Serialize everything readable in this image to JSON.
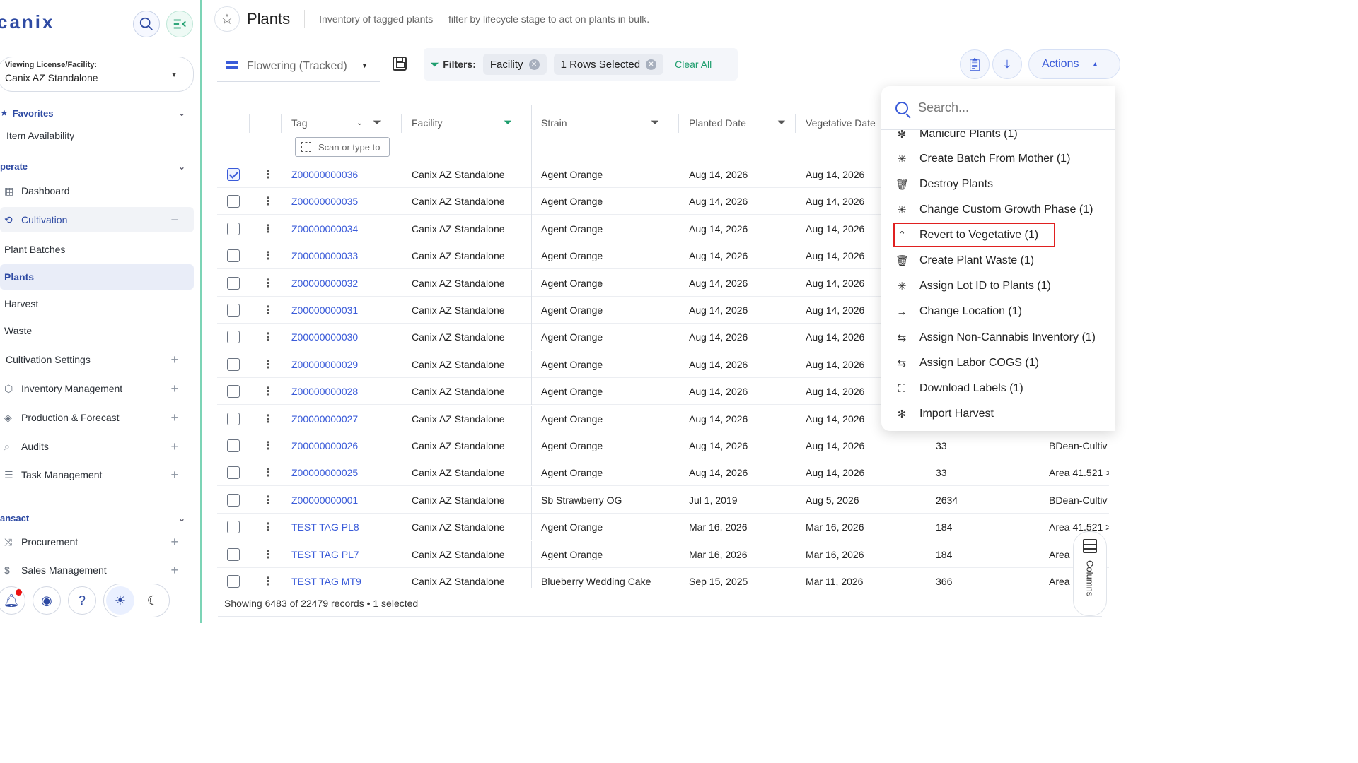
{
  "app": {
    "logo": "canix"
  },
  "sidebar": {
    "license_label": "Viewing License/Facility:",
    "license_value": "Canix AZ Standalone",
    "favorites_label": "Favorites",
    "favorite_item": "Item Availability",
    "operate_label": "perate",
    "items": [
      {
        "label": "Dashboard"
      },
      {
        "label": "Cultivation"
      },
      {
        "label": "Plant Batches"
      },
      {
        "label": "Plants"
      },
      {
        "label": "Harvest"
      },
      {
        "label": "Waste"
      },
      {
        "label": "Cultivation Settings"
      },
      {
        "label": "Inventory Management"
      },
      {
        "label": "Production & Forecast"
      },
      {
        "label": "Audits"
      },
      {
        "label": "Task Management"
      }
    ],
    "transact_label": "ansact",
    "transact_items": [
      {
        "label": "Procurement"
      },
      {
        "label": "Sales Management"
      }
    ]
  },
  "header": {
    "title": "Plants",
    "description": "Inventory of tagged plants — filter by lifecycle stage to act on plants in bulk."
  },
  "toolbar": {
    "view": "Flowering (Tracked)",
    "filters_label": "Filters:",
    "chips": [
      "Facility",
      "1 Rows Selected"
    ],
    "clear_all": "Clear All",
    "actions_label": "Actions"
  },
  "table": {
    "headers": {
      "tag": "Tag",
      "facility": "Facility",
      "strain": "Strain",
      "planted": "Planted Date",
      "vegetative": "Vegetative Date"
    },
    "scan_placeholder": "Scan or type to",
    "rows": [
      {
        "tag": "Z00000000036",
        "facility": "Canix AZ Standalone",
        "strain": "Agent Orange",
        "planted": "Aug 14, 2026",
        "veg": "Aug 14, 2026",
        "c6": "",
        "c7": ""
      },
      {
        "tag": "Z00000000035",
        "facility": "Canix AZ Standalone",
        "strain": "Agent Orange",
        "planted": "Aug 14, 2026",
        "veg": "Aug 14, 2026",
        "c6": "",
        "c7": ""
      },
      {
        "tag": "Z00000000034",
        "facility": "Canix AZ Standalone",
        "strain": "Agent Orange",
        "planted": "Aug 14, 2026",
        "veg": "Aug 14, 2026",
        "c6": "",
        "c7": ""
      },
      {
        "tag": "Z00000000033",
        "facility": "Canix AZ Standalone",
        "strain": "Agent Orange",
        "planted": "Aug 14, 2026",
        "veg": "Aug 14, 2026",
        "c6": "",
        "c7": ""
      },
      {
        "tag": "Z00000000032",
        "facility": "Canix AZ Standalone",
        "strain": "Agent Orange",
        "planted": "Aug 14, 2026",
        "veg": "Aug 14, 2026",
        "c6": "",
        "c7": ""
      },
      {
        "tag": "Z00000000031",
        "facility": "Canix AZ Standalone",
        "strain": "Agent Orange",
        "planted": "Aug 14, 2026",
        "veg": "Aug 14, 2026",
        "c6": "",
        "c7": ""
      },
      {
        "tag": "Z00000000030",
        "facility": "Canix AZ Standalone",
        "strain": "Agent Orange",
        "planted": "Aug 14, 2026",
        "veg": "Aug 14, 2026",
        "c6": "",
        "c7": ""
      },
      {
        "tag": "Z00000000029",
        "facility": "Canix AZ Standalone",
        "strain": "Agent Orange",
        "planted": "Aug 14, 2026",
        "veg": "Aug 14, 2026",
        "c6": "",
        "c7": ""
      },
      {
        "tag": "Z00000000028",
        "facility": "Canix AZ Standalone",
        "strain": "Agent Orange",
        "planted": "Aug 14, 2026",
        "veg": "Aug 14, 2026",
        "c6": "",
        "c7": ""
      },
      {
        "tag": "Z00000000027",
        "facility": "Canix AZ Standalone",
        "strain": "Agent Orange",
        "planted": "Aug 14, 2026",
        "veg": "Aug 14, 2026",
        "c6": "",
        "c7": ""
      },
      {
        "tag": "Z00000000026",
        "facility": "Canix AZ Standalone",
        "strain": "Agent Orange",
        "planted": "Aug 14, 2026",
        "veg": "Aug 14, 2026",
        "c6": "33",
        "c7": "BDean-Cultiv"
      },
      {
        "tag": "Z00000000025",
        "facility": "Canix AZ Standalone",
        "strain": "Agent Orange",
        "planted": "Aug 14, 2026",
        "veg": "Aug 14, 2026",
        "c6": "33",
        "c7": "Area 41.521 >"
      },
      {
        "tag": "Z00000000001",
        "facility": "Canix AZ Standalone",
        "strain": "Sb Strawberry OG",
        "planted": "Jul 1, 2019",
        "veg": "Aug 5, 2026",
        "c6": "2634",
        "c7": "BDean-Cultiv"
      },
      {
        "tag": "TEST TAG PL8",
        "facility": "Canix AZ Standalone",
        "strain": "Agent Orange",
        "planted": "Mar 16, 2026",
        "veg": "Mar 16, 2026",
        "c6": "184",
        "c7": "Area 41.521 >"
      },
      {
        "tag": "TEST TAG PL7",
        "facility": "Canix AZ Standalone",
        "strain": "Agent Orange",
        "planted": "Mar 16, 2026",
        "veg": "Mar 16, 2026",
        "c6": "184",
        "c7": "Area"
      },
      {
        "tag": "TEST TAG MT9",
        "facility": "Canix AZ Standalone",
        "strain": "Blueberry Wedding Cake",
        "planted": "Sep 15, 2025",
        "veg": "Mar 11, 2026",
        "c6": "366",
        "c7": "Area"
      }
    ],
    "footer": "Showing 6483 of 22479 records • 1 selected",
    "columns_label": "Columns"
  },
  "actions_menu": {
    "search_placeholder": "Search...",
    "items": [
      {
        "label": "Manicure Plants (1)",
        "icon": "✻"
      },
      {
        "label": "Create Batch From Mother (1)",
        "icon": "✳"
      },
      {
        "label": "Destroy Plants",
        "icon": "🗑"
      },
      {
        "label": "Change Custom Growth Phase (1)",
        "icon": "✳"
      },
      {
        "label": "Revert to Vegetative (1)",
        "icon": "⌃"
      },
      {
        "label": "Create Plant Waste (1)",
        "icon": "🗑"
      },
      {
        "label": "Assign Lot ID to Plants (1)",
        "icon": "✳"
      },
      {
        "label": "Change Location (1)",
        "icon": "→"
      },
      {
        "label": "Assign Non-Cannabis Inventory (1)",
        "icon": "⇆"
      },
      {
        "label": "Assign Labor COGS (1)",
        "icon": "⇆"
      },
      {
        "label": "Download Labels (1)",
        "icon": "⛶"
      },
      {
        "label": "Import Harvest",
        "icon": "✻"
      }
    ]
  },
  "colors": {
    "accent": "#3a5bd9",
    "green": "#1f9e6e",
    "highlight": "#e02020"
  }
}
